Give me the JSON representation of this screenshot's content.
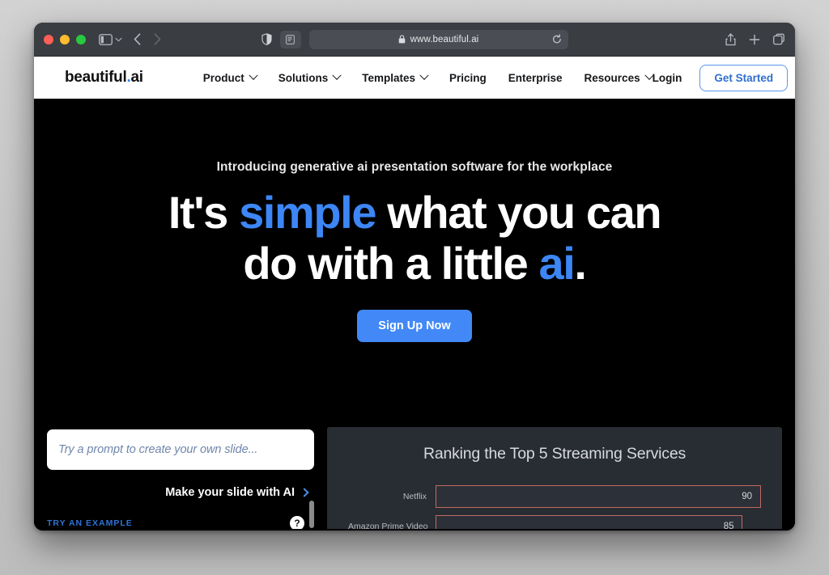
{
  "browser": {
    "url": "www.beautiful.ai",
    "icons": {
      "sidebar": "sidebar-icon",
      "sidebar_chevron": "chevron-down-icon",
      "back": "back-arrow-icon",
      "forward": "forward-arrow-icon",
      "privacy": "shield-icon",
      "reader": "reader-mode-icon",
      "lock": "lock-icon",
      "reload": "reload-icon",
      "share": "share-icon",
      "new_tab": "plus-icon",
      "tab_overview": "tab-overview-icon"
    }
  },
  "site": {
    "logo": {
      "part1": "beautiful",
      "dot": ".",
      "part2": "ai"
    },
    "nav": [
      {
        "label": "Product",
        "has_dropdown": true
      },
      {
        "label": "Solutions",
        "has_dropdown": true
      },
      {
        "label": "Templates",
        "has_dropdown": true
      },
      {
        "label": "Pricing",
        "has_dropdown": false
      },
      {
        "label": "Enterprise",
        "has_dropdown": false
      },
      {
        "label": "Resources",
        "has_dropdown": true
      }
    ],
    "login_label": "Login",
    "get_started_label": "Get Started"
  },
  "hero": {
    "eyebrow": "Introducing generative ai presentation software for the workplace",
    "headline": {
      "line1_part1": "It's ",
      "line1_highlight": "simple",
      "line1_part2": " what you can do",
      "line2_part1": "with a little ",
      "line2_highlight": "ai",
      "line2_part2": "."
    },
    "cta_label": "Sign Up Now"
  },
  "prompt_pane": {
    "placeholder": "Try a prompt to create your own slide...",
    "make_label": "Make your slide with AI",
    "try_example_label": "TRY AN EXAMPLE",
    "help_glyph": "?"
  },
  "slide": {
    "title": "Ranking the Top 5 Streaming Services"
  },
  "chart_data": {
    "type": "bar",
    "title": "Ranking the Top 5 Streaming Services",
    "orientation": "horizontal",
    "categories": [
      "Netflix",
      "Amazon Prime Video"
    ],
    "values": [
      90,
      85
    ],
    "xlabel": "",
    "ylabel": "",
    "xlim": [
      0,
      100
    ],
    "grid": false,
    "legend": "none",
    "note": "Only the first two of five bars are visible; the list is cut off by the viewport."
  },
  "colors": {
    "accent_blue": "#4289f7",
    "link_blue": "#2f72d6",
    "hero_bg": "#000000",
    "slide_bg": "#282c33",
    "bar_outline": "#bf6a60"
  }
}
